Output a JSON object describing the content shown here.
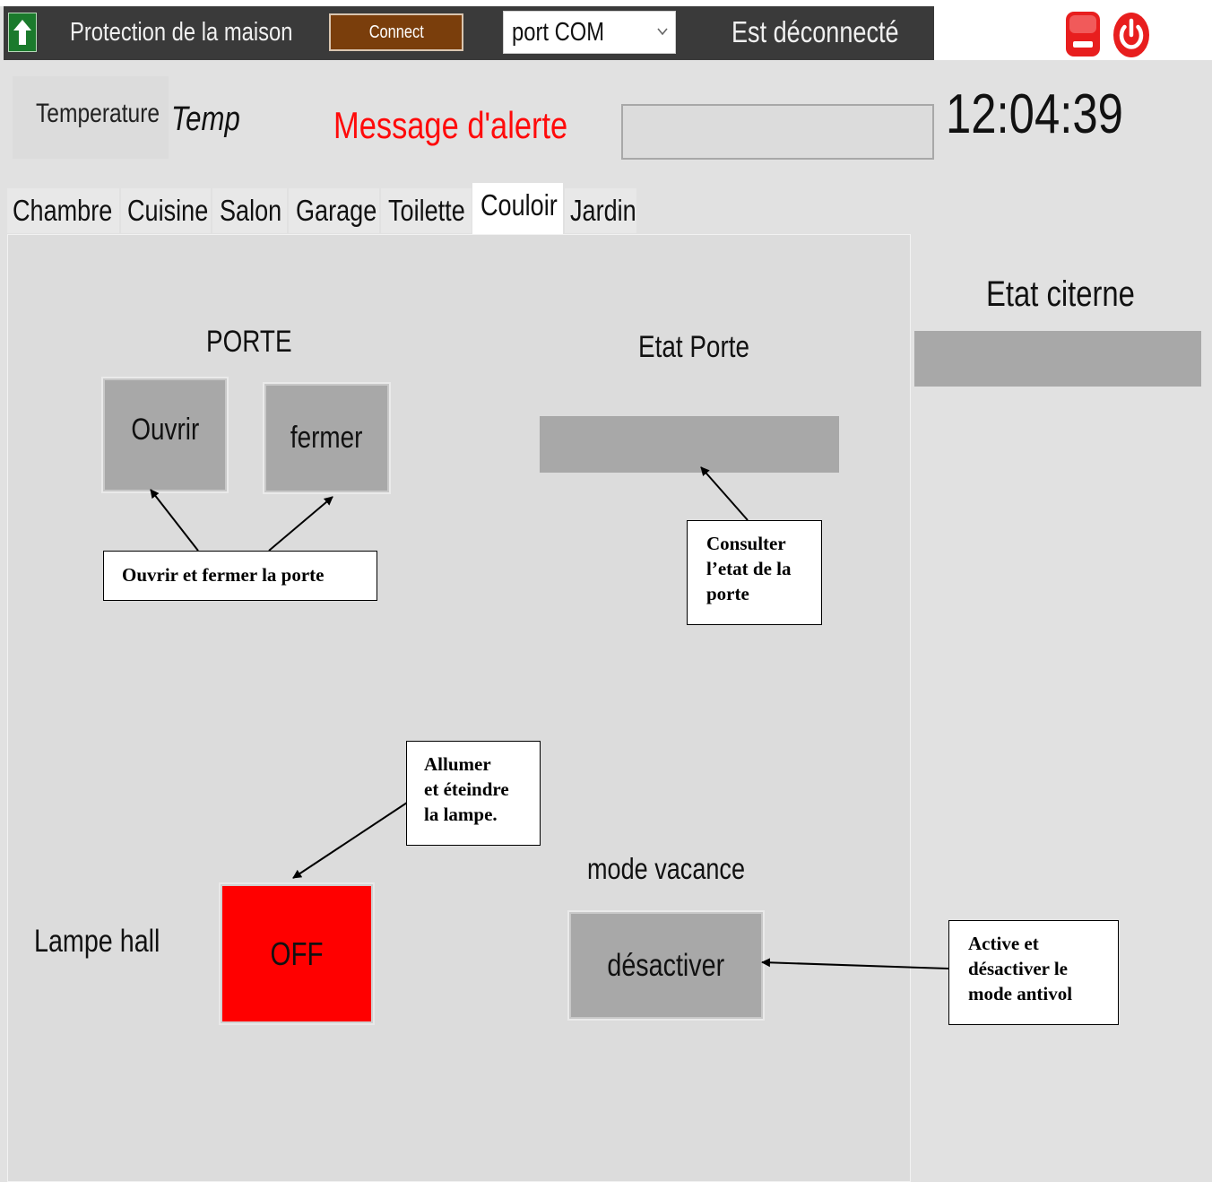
{
  "header": {
    "app_title": "Protection de la maison",
    "connect_label": "Connect",
    "port_select": {
      "value": "port COM"
    },
    "connection_status": "Est déconnecté",
    "colors": {
      "bar": "#3a3a3a",
      "connect": "#7a3e0c",
      "home": "#1b7a2c",
      "stop": "#e81e1e"
    },
    "icons": [
      "home-up-arrow-icon",
      "chevron-down-icon",
      "stop-icon",
      "power-icon"
    ]
  },
  "info": {
    "temperature_label": "Temperature",
    "temperature_value": "Temp",
    "alert_label": "Message d'alerte",
    "alert_value": "",
    "clock": "12:04:39"
  },
  "tabs": [
    {
      "label": "Chambre",
      "active": false
    },
    {
      "label": "Cuisine",
      "active": false
    },
    {
      "label": "Salon",
      "active": false
    },
    {
      "label": "Garage",
      "active": false
    },
    {
      "label": "Toilette",
      "active": false
    },
    {
      "label": "Couloir",
      "active": true
    },
    {
      "label": "Jardin",
      "active": false
    }
  ],
  "couloir": {
    "porte_heading": "PORTE",
    "open_button": "Ouvrir",
    "close_button": "fermer",
    "door_state_heading": "Etat Porte",
    "door_state_value": "",
    "lamp_label": "Lampe hall",
    "lamp_button": "OFF",
    "vacation_heading": "mode vacance",
    "vacation_button": "désactiver"
  },
  "side": {
    "tank_heading": "Etat citerne",
    "tank_value": ""
  },
  "annotations": {
    "door_buttons": "Ouvrir et fermer la porte",
    "door_state": [
      "Consulter",
      "l’etat de la",
      "porte"
    ],
    "lamp": [
      "Allumer",
      "et éteindre",
      "la lampe."
    ],
    "vacation": [
      "Active et",
      "désactiver le",
      "mode antivol"
    ]
  }
}
